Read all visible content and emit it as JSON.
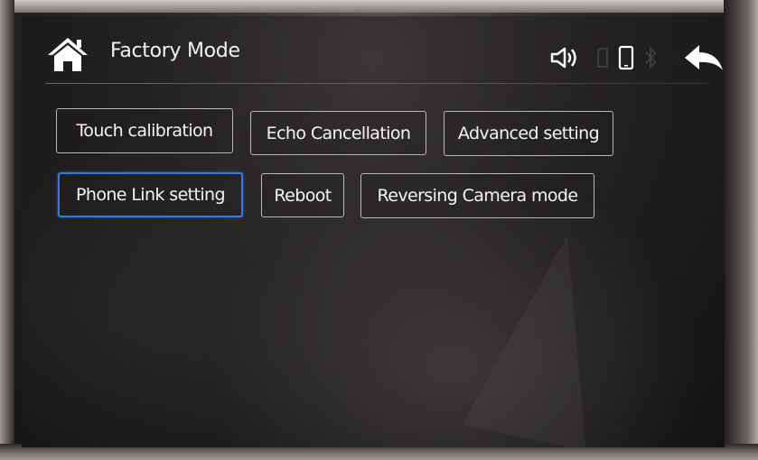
{
  "header": {
    "title": "Factory Mode",
    "icons": [
      "home-icon",
      "volume-icon",
      "storage-icon",
      "phone-icon",
      "bluetooth-icon",
      "back-icon"
    ]
  },
  "buttons": {
    "touch_calibration": "Touch calibration",
    "echo_cancellation": "Echo Cancellation",
    "advanced_setting": "Advanced setting",
    "phone_link_setting": "Phone Link setting",
    "reboot": "Reboot",
    "reversing_camera_mode": "Reversing Camera mode"
  },
  "selected_button": "phone_link_setting",
  "colors": {
    "selection_accent": "#2e7bf0",
    "button_border": "#b8b8b8",
    "text": "#f4f4f4"
  }
}
